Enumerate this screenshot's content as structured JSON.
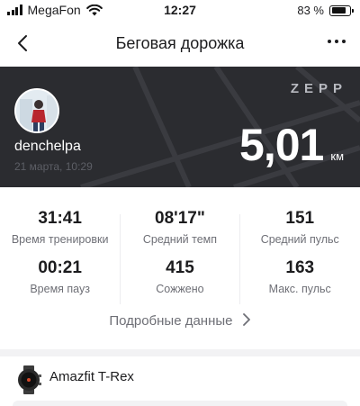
{
  "status_bar": {
    "carrier": "MegaFon",
    "time": "12:27",
    "battery": "83 %",
    "battery_level": 0.83,
    "icons": [
      "signal-icon",
      "wifi-icon",
      "battery-icon"
    ]
  },
  "nav": {
    "title": "Беговая дорожка",
    "back_icon": "chevron-left-icon",
    "more_icon": "more-icon"
  },
  "hero": {
    "brand": "ZEPP",
    "username": "denchelpa",
    "date": "21 марта, 10:29",
    "distance_value": "5,01",
    "distance_unit": "км"
  },
  "stats": [
    {
      "value": "31:41",
      "label": "Время тренировки"
    },
    {
      "value": "08'17\"",
      "label": "Средний темп"
    },
    {
      "value": "151",
      "label": "Средний пульс"
    },
    {
      "value": "00:21",
      "label": "Время пауз"
    },
    {
      "value": "415",
      "label": "Сожжено"
    },
    {
      "value": "163",
      "label": "Макс. пульс"
    }
  ],
  "details_link": "Подробные данные",
  "device": {
    "name": "Amazfit T-Rex",
    "icon": "watch-icon"
  },
  "colors": {
    "hero_bg": "#2b2c30",
    "page_bg": "#f2f2f4",
    "muted_text": "#6e6f76"
  }
}
